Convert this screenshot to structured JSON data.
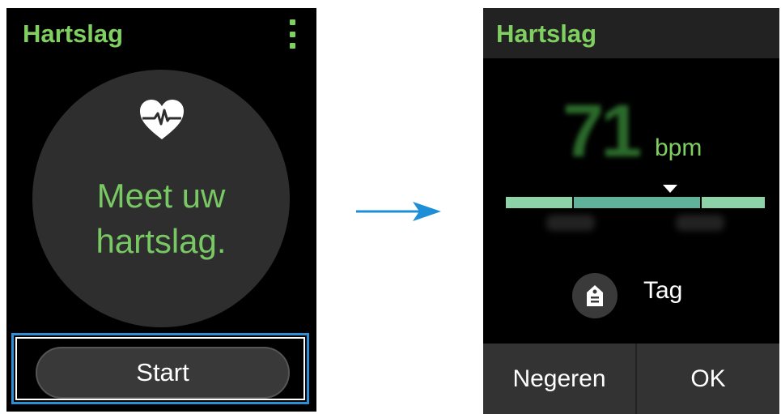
{
  "left_screen": {
    "title": "Hartslag",
    "message": "Meet uw\nhartslag.",
    "start_label": "Start",
    "menu_icon": "more-vertical-icon",
    "heart_icon": "heart-pulse-icon"
  },
  "right_screen": {
    "title": "Hartslag",
    "bpm_value": "71",
    "bpm_unit": "bpm",
    "tag_label": "Tag",
    "tag_icon": "tag-icon",
    "ignore_label": "Negeren",
    "ok_label": "OK"
  },
  "colors": {
    "title_green": "#7fd061",
    "highlight_blue": "#2f8fd6",
    "arrow_blue": "#1e8fd6"
  }
}
